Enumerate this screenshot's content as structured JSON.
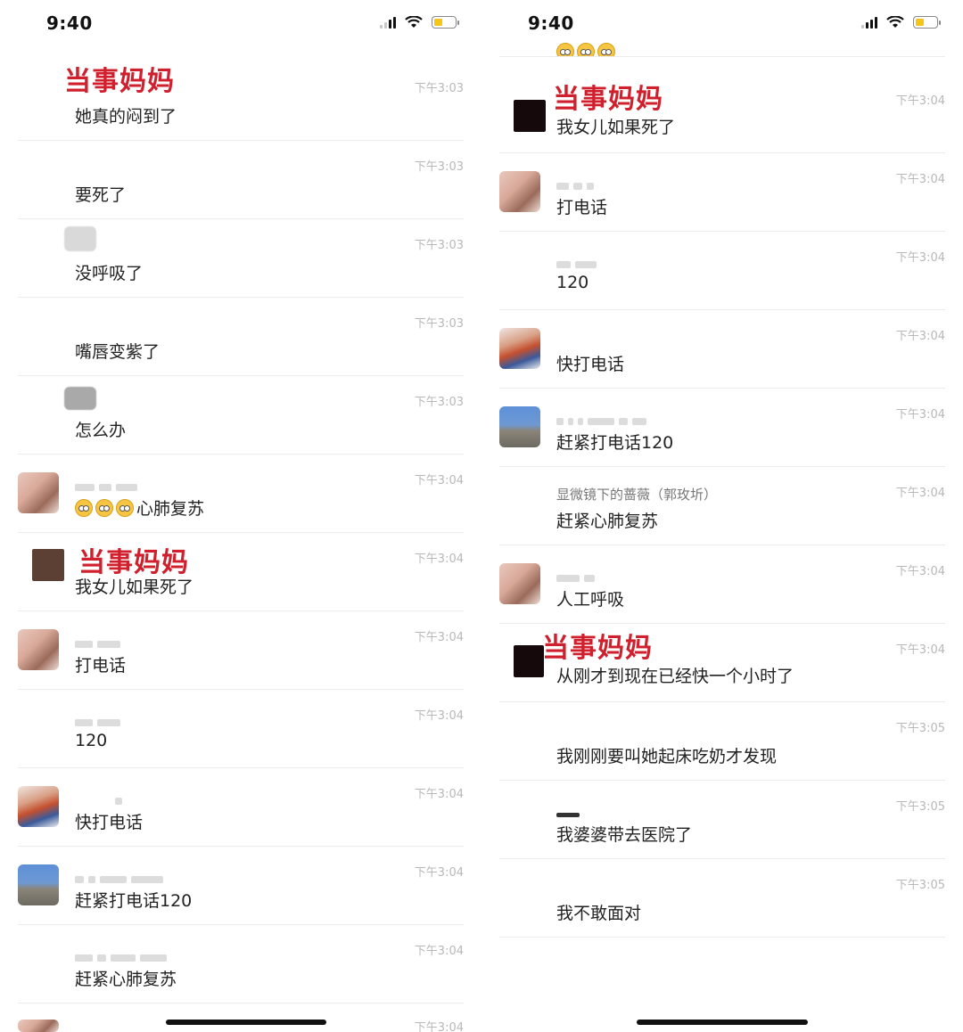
{
  "status_time": "9:40",
  "red_label": "当事妈妈",
  "left": {
    "messages": [
      {
        "text": "她真的闷到了",
        "time": "下午3:03"
      },
      {
        "text": "要死了",
        "time": "下午3:03"
      },
      {
        "text": "没呼吸了",
        "time": "下午3:03"
      },
      {
        "text": "嘴唇变紫了",
        "time": "下午3:03"
      },
      {
        "text": "怎么办",
        "time": "下午3:03"
      },
      {
        "text": "心肺复苏",
        "time": "下午3:04"
      },
      {
        "text": "我女儿如果死了",
        "time": "下午3:04"
      },
      {
        "text": "打电话",
        "time": "下午3:04"
      },
      {
        "text": "120",
        "time": "下午3:04"
      },
      {
        "text": "快打电话",
        "time": "下午3:04"
      },
      {
        "text": "赶紧打电话120",
        "time": "下午3:04"
      },
      {
        "text": "赶紧心肺复苏",
        "time": "下午3:04"
      },
      {
        "text": "",
        "time": "下午3:04"
      }
    ]
  },
  "right": {
    "messages": [
      {
        "text": "我女儿如果死了",
        "time": "下午3:04"
      },
      {
        "text": "打电话",
        "time": "下午3:04"
      },
      {
        "text": "120",
        "time": "下午3:04"
      },
      {
        "text": "快打电话",
        "time": "下午3:04"
      },
      {
        "text": "赶紧打电话120",
        "time": "下午3:04"
      },
      {
        "sender": "显微镜下的蔷薇（郭玫圻）",
        "text": "赶紧心肺复苏",
        "time": "下午3:04"
      },
      {
        "text": "人工呼吸",
        "time": "下午3:04"
      },
      {
        "text": "从刚才到现在已经快一个小时了",
        "time": "下午3:04"
      },
      {
        "text": "我刚刚要叫她起床吃奶才发现",
        "time": "下午3:05"
      },
      {
        "text": "我婆婆带去医院了",
        "time": "下午3:05"
      },
      {
        "text": "我不敢面对",
        "time": "下午3:05"
      }
    ]
  }
}
